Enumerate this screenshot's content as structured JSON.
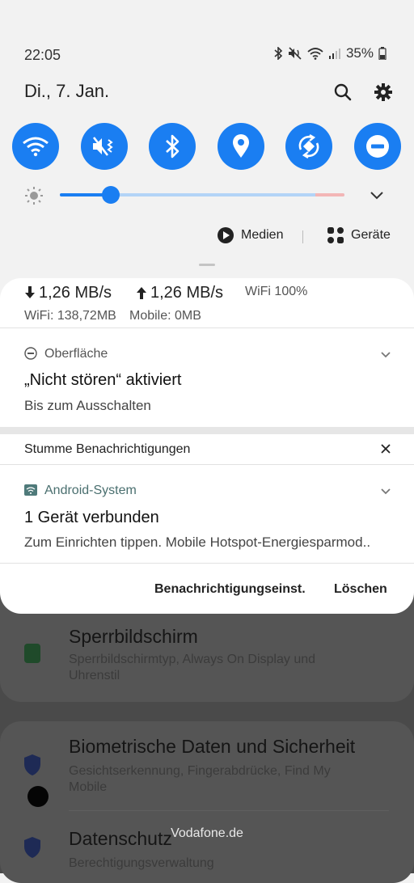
{
  "status_bar": {
    "time": "22:05",
    "battery": "35%"
  },
  "header": {
    "date": "Di., 7. Jan."
  },
  "quick_toggles": [
    {
      "name": "wifi-icon"
    },
    {
      "name": "mute-vibrate-icon"
    },
    {
      "name": "bluetooth-icon"
    },
    {
      "name": "location-icon"
    },
    {
      "name": "auto-rotate-icon"
    },
    {
      "name": "do-not-disturb-icon"
    }
  ],
  "brightness": {
    "level": 0.18
  },
  "media_row": {
    "media_label": "Medien",
    "devices_label": "Geräte"
  },
  "net_speed": {
    "down": "1,26 MB/s",
    "up": "1,26 MB/s",
    "wifi": "WiFi 100%",
    "wifi_usage": "WiFi: 138,72MB",
    "mobile_usage": "Mobile: 0MB"
  },
  "dnd_notification": {
    "app": "Oberfläche",
    "title": "„Nicht stören“ aktiviert",
    "text": "Bis zum Ausschalten"
  },
  "silent_section": {
    "label": "Stumme Benachrichtigungen"
  },
  "system_notification": {
    "app": "Android-System",
    "title": "1 Gerät verbunden",
    "text": "Zum Einrichten tippen. Mobile Hotspot-Energiesparmod.."
  },
  "footer": {
    "settings_button": "Benachrichtigungseinst.",
    "clear_button": "Löschen"
  },
  "background_settings": [
    {
      "title": "Sperrbildschirm",
      "subtitle": "Sperrbildschirmtyp, Always On Display und Uhrenstil"
    },
    {
      "title": "Biometrische Daten und Sicherheit",
      "subtitle": "Gesichtserkennung, Fingerabdrücke, Find My Mobile"
    },
    {
      "title": "Datenschutz",
      "subtitle": "Berechtigungsverwaltung"
    }
  ],
  "toast": {
    "text": "Vodafone.de"
  },
  "colors": {
    "accent": "#1a7ef2",
    "panel_bg": "#ffffff",
    "shade_bg": "#f2f2f2"
  }
}
